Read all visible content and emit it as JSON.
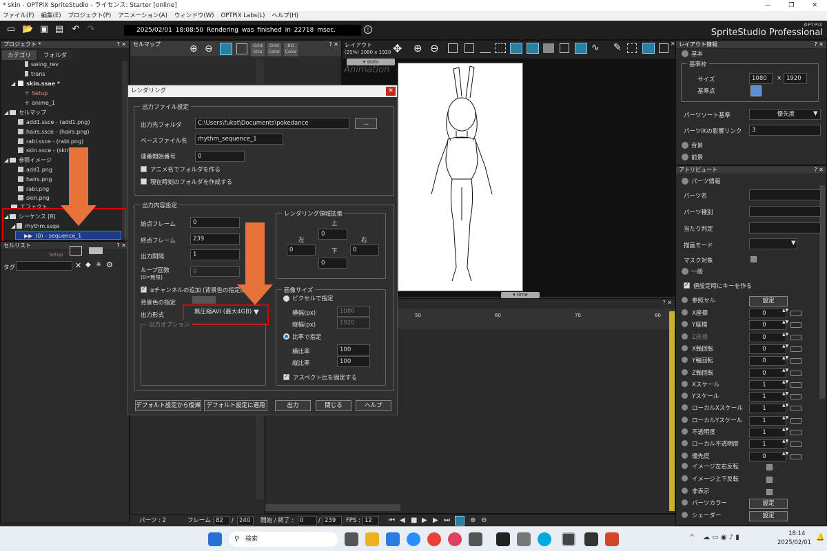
{
  "window": {
    "title": "* skin - OPTPiX SpriteStudio - ライセンス: Starter [online]"
  },
  "menu": [
    "ファイル(F)",
    "編集(E)",
    "プロジェクト(P)",
    "アニメーション(A)",
    "ウィンドウ(W)",
    "OPTPiX Labs(L)",
    "ヘルプ(H)"
  ],
  "status": {
    "text": "2025/02/01 18:08:50   Rendering was finished in 22718 msec."
  },
  "logo": {
    "small": "OPTPiX",
    "main": "SpriteStudio Professional"
  },
  "project_panel": {
    "title": "プロジェクト *",
    "tabs": [
      "カテゴリ",
      "フォルダ"
    ],
    "items": [
      {
        "label": "swing_rev"
      },
      {
        "label": "trans"
      },
      {
        "label": "skin.ssae *"
      },
      {
        "label": "Setup"
      },
      {
        "label": "anime_1"
      },
      {
        "label": "セルマップ"
      },
      {
        "label": "add1.ssce - (add1.png)"
      },
      {
        "label": "hairs.ssce - (hairs.png)"
      },
      {
        "label": "rabi.ssce - (rabi.png)"
      },
      {
        "label": "skin.ssce - (skin."
      },
      {
        "label": "参照イメージ"
      },
      {
        "label": "add1.png"
      },
      {
        "label": "hairs.png"
      },
      {
        "label": "rabi.png"
      },
      {
        "label": "skin.png"
      },
      {
        "label": "エフェクト"
      },
      {
        "label": "シーケンス [8]"
      },
      {
        "label": "rhythm.ssqe"
      },
      {
        "label": "(0) - sequence_1"
      }
    ]
  },
  "cell_list": {
    "title": "セルリスト",
    "setup": "Setup",
    "tag_label": "タグ"
  },
  "cellmap_panel": {
    "title": "セルマップ",
    "tools": [
      "Grid Size",
      "Grid Color",
      "BG Color"
    ]
  },
  "layout_panel": {
    "title": "レイアウト",
    "info": "(25%) 1080 x 1920",
    "stats_tab": "▾ stats",
    "watermark": "Animation",
    "time_tab": "▾ time"
  },
  "timeline": {
    "ticks": [
      "50",
      "60",
      "70",
      "80"
    ]
  },
  "render_dialog": {
    "title": "レンダリング",
    "output_group": "出力ファイル設定",
    "folder_label": "出力先フォルダ",
    "folder_value": "C:\\Users\\fukat\\Documents\\pokedance",
    "browse": "...",
    "basename_label": "ベースファイル名",
    "basename_value": "rhythm_sequence_1",
    "seq_label": "連番開始番号",
    "seq_value": "0",
    "cb_anim_folder": "アニメ名でフォルダを作る",
    "cb_time_folder": "現在時刻のフォルダを作成する",
    "content_group": "出力内容設定",
    "start_label": "始点フレーム",
    "start_value": "0",
    "end_label": "終点フレーム",
    "end_value": "239",
    "interval_label": "出力間隔",
    "interval_value": "1",
    "loop_label": "ループ回数",
    "loop_sub": "(0=無限)",
    "loop_value": "0",
    "alpha_label": "αチャンネルの追加 (背景色の指定は",
    "bg_label": "背景色の指定",
    "format_label": "出力形式",
    "format_value": "無圧縮AVI (最大4GB)",
    "options_label": "出力オプション",
    "expand_group": "レンダリング領域拡張",
    "up": "上",
    "left": "左",
    "right": "右",
    "down": "下",
    "up_val": "0",
    "left_val": "0",
    "right_val": "0",
    "down_val": "0",
    "size_group": "画像サイズ",
    "px_radio": "ピクセルで指定",
    "w_label": "横幅(px)",
    "w_value": "1080",
    "h_label": "縦幅(px)",
    "h_value": "1920",
    "ratio_radio": "比率で指定",
    "wr_label": "横比率",
    "wr_value": "100",
    "hr_label": "縦比率",
    "hr_value": "100",
    "aspect_label": "アスペクト比を固定する",
    "buttons": [
      "デフォルト設定から復帰",
      "デフォルト設定に適用",
      "出力",
      "閉じる",
      "ヘルプ"
    ]
  },
  "bottom_bar": {
    "parts_label": "パーツ : 2",
    "frame_label": "フレーム :",
    "frame_value": "82",
    "frame_total": "240",
    "range_label": "開始 / 終了 :",
    "range_start": "0",
    "range_end": "239",
    "fps_label": "FPS :",
    "fps_value": "12"
  },
  "layout_info": {
    "title": "レイアウト情報",
    "basic": "基本",
    "base_frame": "基準枠",
    "size_label": "サイズ",
    "size_w": "1080",
    "size_h": "1920",
    "origin_label": "基準点",
    "sort_label": "パーツソート基準",
    "sort_value": "優先度",
    "ik_label": "パーツIKの影響リンク",
    "ik_value": "3",
    "bg": "背景",
    "fg": "前景"
  },
  "attributes": {
    "title": "アトリビュート",
    "parts_info": "パーツ情報",
    "part_name": "パーツ名",
    "part_type": "パーツ種別",
    "hit": "当たり判定",
    "draw_mode": "描画モード",
    "mask": "マスク対象",
    "general": "一般",
    "key_on_set": "値設定時にキーを作る",
    "ref_cell": "参照セル",
    "set_btn": "設定",
    "rows": [
      {
        "label": "X座標",
        "value": "0"
      },
      {
        "label": "Y座標",
        "value": "0"
      },
      {
        "label": "Z座標",
        "value": "0"
      },
      {
        "label": "X軸回転",
        "value": "0"
      },
      {
        "label": "Y軸回転",
        "value": "0"
      },
      {
        "label": "Z軸回転",
        "value": "0"
      },
      {
        "label": "Xスケール",
        "value": "1"
      },
      {
        "label": "Yスケール",
        "value": "1"
      },
      {
        "label": "ローカルXスケール",
        "value": "1"
      },
      {
        "label": "ローカルYスケール",
        "value": "1"
      },
      {
        "label": "不透明度",
        "value": "1"
      },
      {
        "label": "ローカル不透明度",
        "value": "1"
      },
      {
        "label": "優先度",
        "value": "0"
      }
    ],
    "flip_h": "イメージ左右反転",
    "flip_v": "イメージ上下反転",
    "hidden": "非表示",
    "part_color": "パーツカラー",
    "shader": "シェーダー"
  },
  "taskbar": {
    "search": "検索",
    "time": "18:14",
    "date": "2025/02/01"
  }
}
